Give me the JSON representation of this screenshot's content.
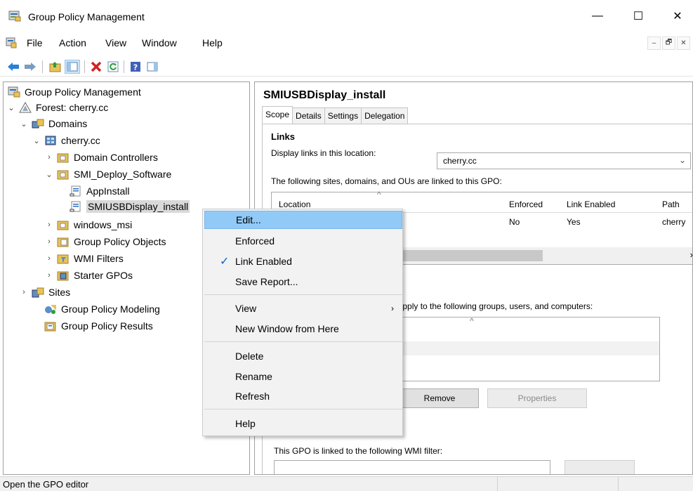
{
  "window": {
    "title": "Group Policy Management",
    "min": "—",
    "max": "☐",
    "close": "✕"
  },
  "menu": [
    "File",
    "Action",
    "View",
    "Window",
    "Help"
  ],
  "mdi": [
    "–",
    "🗗",
    "✕"
  ],
  "tree": {
    "root": "Group Policy Management",
    "forest": "Forest: cherry.cc",
    "domains": "Domains",
    "domain": "cherry.cc",
    "domain_controllers": "Domain Controllers",
    "ou": "SMI_Deploy_Software",
    "gpo1": "AppInstall",
    "gpo2": "SMIUSBDisplay_install",
    "windows_msi": "windows_msi",
    "gp_objects": "Group Policy Objects",
    "wmi": "WMI Filters",
    "starter": "Starter GPOs",
    "sites": "Sites",
    "modeling": "Group Policy Modeling",
    "results": "Group Policy Results"
  },
  "details": {
    "title": "SMIUSBDisplay_install",
    "tabs": [
      "Scope",
      "Details",
      "Settings",
      "Delegation"
    ],
    "links_heading": "Links",
    "display_label": "Display links in this location:",
    "location_value": "cherry.cc",
    "linked_label": "The following sites, domains, and OUs are linked to this GPO:",
    "columns": [
      "Location",
      "Enforced",
      "Link Enabled",
      "Path"
    ],
    "row": {
      "enforced": "No",
      "enabled": "Yes",
      "path": "cherry"
    },
    "filter_label": "nly apply to the following groups, users, and computers:",
    "remove": "Remove",
    "properties": "Properties",
    "wmi_label": "This GPO is linked to the following WMI filter:"
  },
  "context_menu": {
    "edit": "Edit...",
    "enforced": "Enforced",
    "link_enabled": "Link Enabled",
    "save_report": "Save Report...",
    "view": "View",
    "new_window": "New Window from Here",
    "delete": "Delete",
    "rename": "Rename",
    "refresh": "Refresh",
    "help": "Help"
  },
  "status": "Open the GPO editor"
}
